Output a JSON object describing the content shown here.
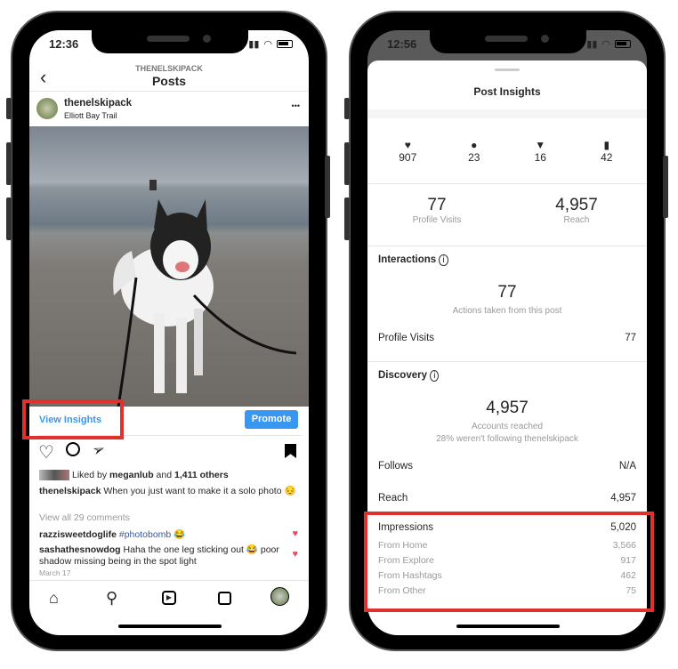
{
  "left": {
    "time": "12:36",
    "header_sub": "THENELSKIPACK",
    "header_title": "Posts",
    "username": "thenelskipack",
    "location": "Elliott Bay Trail",
    "more": "•••",
    "view_insights": "View Insights",
    "promote": "Promote",
    "liked_prefix": "Liked by ",
    "liked_user": "meganlub",
    "liked_mid": " and ",
    "liked_count": "1,411 others",
    "caption_user": "thenelskipack",
    "caption_text": " When you just want to make it a solo photo 😔",
    "view_comments": "View all 29 comments",
    "comments": [
      {
        "user": "razzisweetdoglife",
        "text": " #photobomb 😂"
      },
      {
        "user": "sashathesnowdog",
        "text": " Haha the one leg sticking out 😂 poor shadow missing being in the spot light"
      }
    ],
    "date": "March 17",
    "accent": "#3897f0"
  },
  "right": {
    "time": "12:56",
    "title": "Post Insights",
    "stats": [
      {
        "icon": "heart-icon",
        "value": "907"
      },
      {
        "icon": "comment-icon",
        "value": "23"
      },
      {
        "icon": "share-icon",
        "value": "16"
      },
      {
        "icon": "bookmark-icon",
        "value": "42"
      }
    ],
    "profile_visits_value": "77",
    "profile_visits_label": "Profile Visits",
    "reach_value": "4,957",
    "reach_label": "Reach",
    "interactions_title": "Interactions",
    "interactions_value": "77",
    "interactions_caption": "Actions taken from this post",
    "profile_visits_row": {
      "label": "Profile Visits",
      "value": "77"
    },
    "discovery_title": "Discovery",
    "discovery_value": "4,957",
    "discovery_caption": "Accounts reached",
    "discovery_sub": "28% weren't following thenelskipack",
    "follows": {
      "label": "Follows",
      "value": "N/A"
    },
    "reach_row": {
      "label": "Reach",
      "value": "4,957"
    },
    "impressions": {
      "label": "Impressions",
      "value": "5,020"
    },
    "breakdown": [
      {
        "label": "From Home",
        "value": "3,566"
      },
      {
        "label": "From Explore",
        "value": "917"
      },
      {
        "label": "From Hashtags",
        "value": "462"
      },
      {
        "label": "From Other",
        "value": "75"
      }
    ],
    "highlight": "#e0312b"
  }
}
